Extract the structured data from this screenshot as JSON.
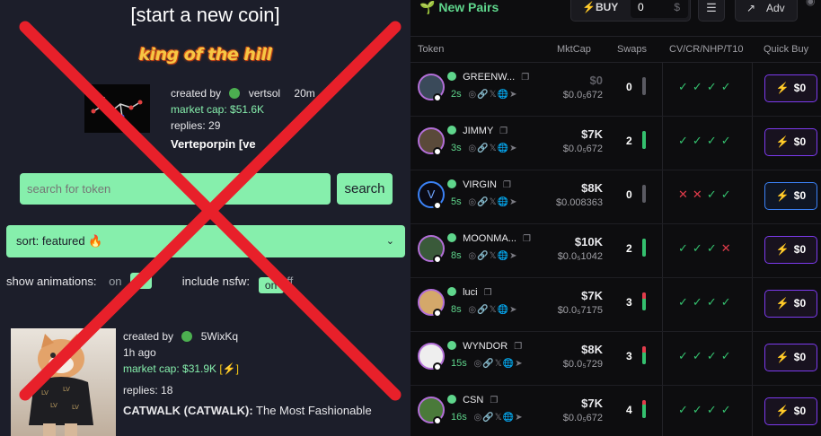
{
  "left": {
    "start_link": "[start a new coin]",
    "king_title": "king of the hill",
    "king": {
      "created_by_label": "created by",
      "creator": "vertsol",
      "age": "20m",
      "market_cap": "market cap: $51.6K",
      "replies": "replies: 29",
      "name": "Verteporpin [ve"
    },
    "search": {
      "placeholder": "search for token",
      "button": "search"
    },
    "sort_label": "sort: featured 🔥",
    "animations_label": "show animations:",
    "animations_on": "on",
    "nsfw_label": "include nsfw:",
    "nsfw_value": "on",
    "nsfw_off": "ff",
    "card": {
      "created_by_label": "created by",
      "creator": "5WixKq",
      "age": "1h ago",
      "market_cap": "market cap: $31.9K",
      "replies": "replies: 18",
      "name": "CATWALK (CATWALK):",
      "description": "The Most Fashionable"
    },
    "cross_color": "#e8202a"
  },
  "right": {
    "title": "New Pairs",
    "buy_label": "BUY",
    "buy_amount": "0",
    "buy_currency": "$",
    "adv_label": "Adv",
    "columns": [
      "Token",
      "MktCap",
      "Swaps",
      "CV/CR/NHP/T10",
      "Quick Buy"
    ],
    "rows": [
      {
        "name": "GREENW...",
        "age": "2s",
        "mcap": "$0",
        "price": "$0.0₅672",
        "swaps": "0",
        "checks": [
          "ok",
          "ok",
          "ok",
          "ok"
        ],
        "buy": "$0",
        "dim": true,
        "green": 0,
        "red": 0,
        "blue": false
      },
      {
        "name": "JIMMY",
        "age": "3s",
        "mcap": "$7K",
        "price": "$0.0₅672",
        "swaps": "2",
        "checks": [
          "ok",
          "ok",
          "ok",
          "ok"
        ],
        "buy": "$0",
        "dim": false,
        "green": 1,
        "red": 0,
        "blue": false
      },
      {
        "name": "VIRGIN",
        "age": "5s",
        "mcap": "$8K",
        "price": "$0.008363",
        "swaps": "0",
        "checks": [
          "bad",
          "bad",
          "ok",
          "ok"
        ],
        "buy": "$0",
        "dim": false,
        "green": 0,
        "red": 0,
        "blue": true
      },
      {
        "name": "MOONMA...",
        "age": "8s",
        "mcap": "$10K",
        "price": "$0.0₅1042",
        "swaps": "2",
        "checks": [
          "ok",
          "ok",
          "ok",
          "bad"
        ],
        "buy": "$0",
        "dim": false,
        "green": 1,
        "red": 0,
        "blue": false
      },
      {
        "name": "luci",
        "age": "8s",
        "mcap": "$7K",
        "price": "$0.0₅7175",
        "swaps": "3",
        "checks": [
          "ok",
          "ok",
          "ok",
          "ok"
        ],
        "buy": "$0",
        "dim": false,
        "green": 0.66,
        "red": 0.34,
        "blue": false
      },
      {
        "name": "WYNDOR",
        "age": "15s",
        "mcap": "$8K",
        "price": "$0.0₅729",
        "swaps": "3",
        "checks": [
          "ok",
          "ok",
          "ok",
          "ok"
        ],
        "buy": "$0",
        "dim": false,
        "green": 0.66,
        "red": 0.34,
        "blue": false
      },
      {
        "name": "CSN",
        "age": "16s",
        "mcap": "$7K",
        "price": "$0.0₅672",
        "swaps": "4",
        "checks": [
          "ok",
          "ok",
          "ok",
          "ok"
        ],
        "buy": "$0",
        "dim": false,
        "green": 0.75,
        "red": 0.25,
        "blue": false
      }
    ]
  }
}
